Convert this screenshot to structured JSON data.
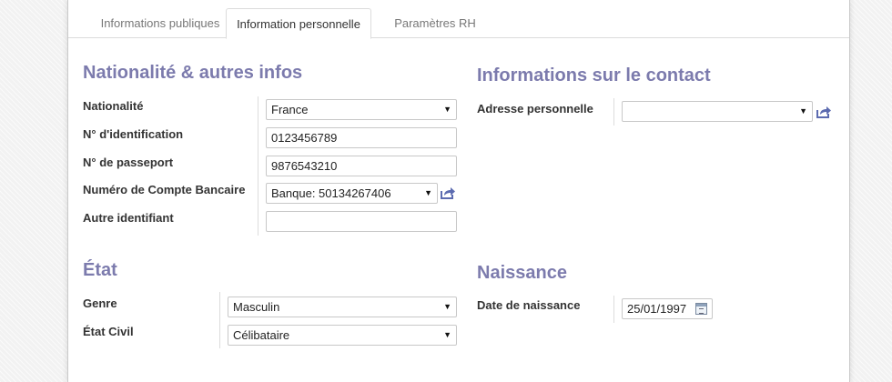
{
  "tabs": [
    {
      "label": "Informations publiques",
      "active": false
    },
    {
      "label": "Information personnelle",
      "active": true
    },
    {
      "label": "Paramètres RH",
      "active": false
    }
  ],
  "nationality_group": {
    "title": "Nationalité & autres infos",
    "fields": [
      {
        "label": "Nationalité",
        "value": "France",
        "type": "select"
      },
      {
        "label": "N° d'identification",
        "value": "0123456789",
        "type": "text"
      },
      {
        "label": "N° de passeport",
        "value": "9876543210",
        "type": "text"
      },
      {
        "label": "Numéro de Compte Bancaire",
        "value": "Banque: 50134267406",
        "type": "select-link"
      },
      {
        "label": "Autre identifiant",
        "value": "",
        "type": "text"
      }
    ]
  },
  "contact_group": {
    "title": "Informations sur le contact",
    "fields": [
      {
        "label": "Adresse personnelle",
        "value": "",
        "type": "select-link"
      }
    ]
  },
  "state_group": {
    "title": "État",
    "fields": [
      {
        "label": "Genre",
        "value": "Masculin",
        "type": "select"
      },
      {
        "label": "État Civil",
        "value": "Célibataire",
        "type": "select"
      }
    ]
  },
  "birth_group": {
    "title": "Naissance",
    "fields": [
      {
        "label": "Date de naissance",
        "value": "25/01/1997",
        "type": "date"
      }
    ]
  },
  "icons": {
    "dropdown": "caret-down-icon",
    "external": "external-link-icon",
    "calendar": "calendar-icon"
  },
  "colors": {
    "group_title": "#7c7bad",
    "external_icon": "#5c6bb0"
  }
}
